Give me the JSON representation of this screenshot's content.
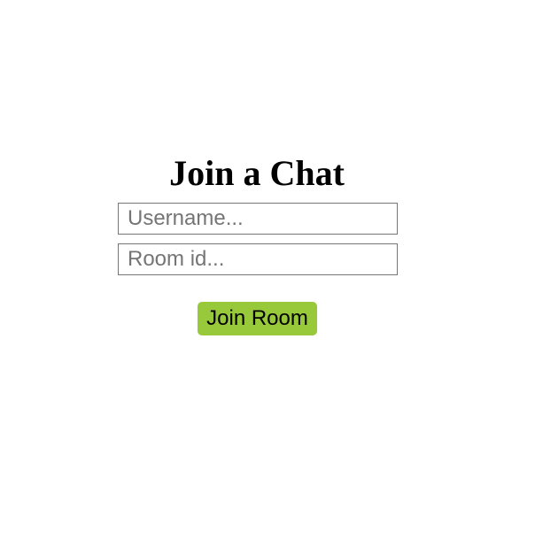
{
  "join": {
    "title": "Join a Chat",
    "username_placeholder": "Username...",
    "username_value": "",
    "room_placeholder": "Room id...",
    "room_value": "",
    "button_label": "Join Room"
  },
  "colors": {
    "button_background": "#97c93a",
    "page_background": "#ffffff"
  }
}
